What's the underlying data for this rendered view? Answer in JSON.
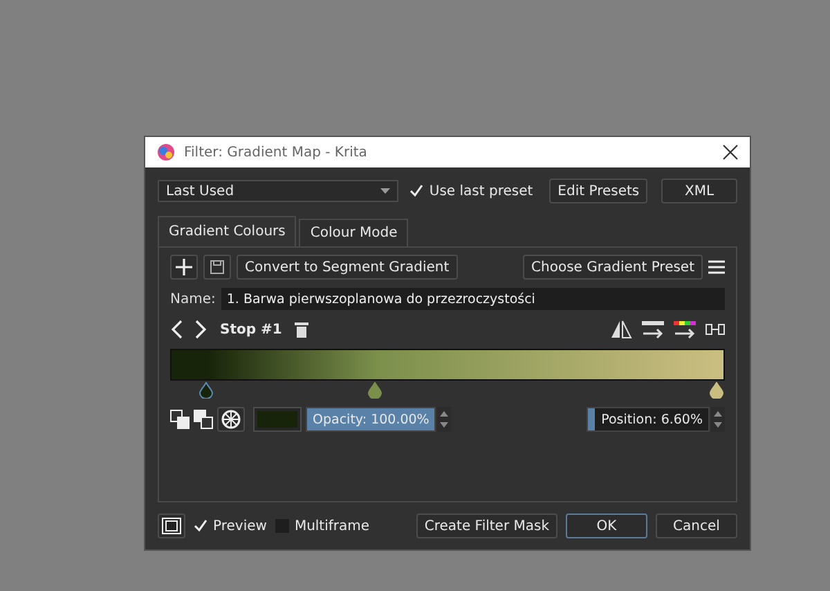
{
  "window": {
    "title": "Filter: Gradient Map - Krita"
  },
  "preset": {
    "value": "Last Used",
    "use_last_preset": {
      "label": "Use last preset",
      "checked": true
    },
    "buttons": [
      "Edit Presets",
      "XML"
    ]
  },
  "tabs": [
    {
      "label": "Gradient Colours",
      "selected": true
    },
    {
      "label": "Colour Mode",
      "selected": false
    }
  ],
  "toolbar": {
    "convert_button": "Convert to Segment Gradient",
    "preset_button": "Choose Gradient Preset"
  },
  "name_field": {
    "label": "Name:",
    "value": "1. Barwa pierwszoplanowa do przezroczystości"
  },
  "stop_nav": {
    "label": "Stop #1"
  },
  "stops": [
    {
      "color": "#17240a",
      "level": 0.066,
      "selected": true
    },
    {
      "color": "#7b8f4b",
      "level": 0.37,
      "selected": false
    },
    {
      "color": "#c9bd80",
      "level": 0.985,
      "selected": false
    }
  ],
  "opacity": {
    "label": "Opacity: 100.00%",
    "level": 1.0
  },
  "position": {
    "label": "Position: 6.60%",
    "level": 0.066
  },
  "footer": {
    "preview": {
      "label": "Preview",
      "checked": true
    },
    "multiframe": {
      "label": "Multiframe",
      "checked": false
    },
    "buttons": [
      "Create Filter Mask",
      "OK",
      "Cancel"
    ]
  }
}
